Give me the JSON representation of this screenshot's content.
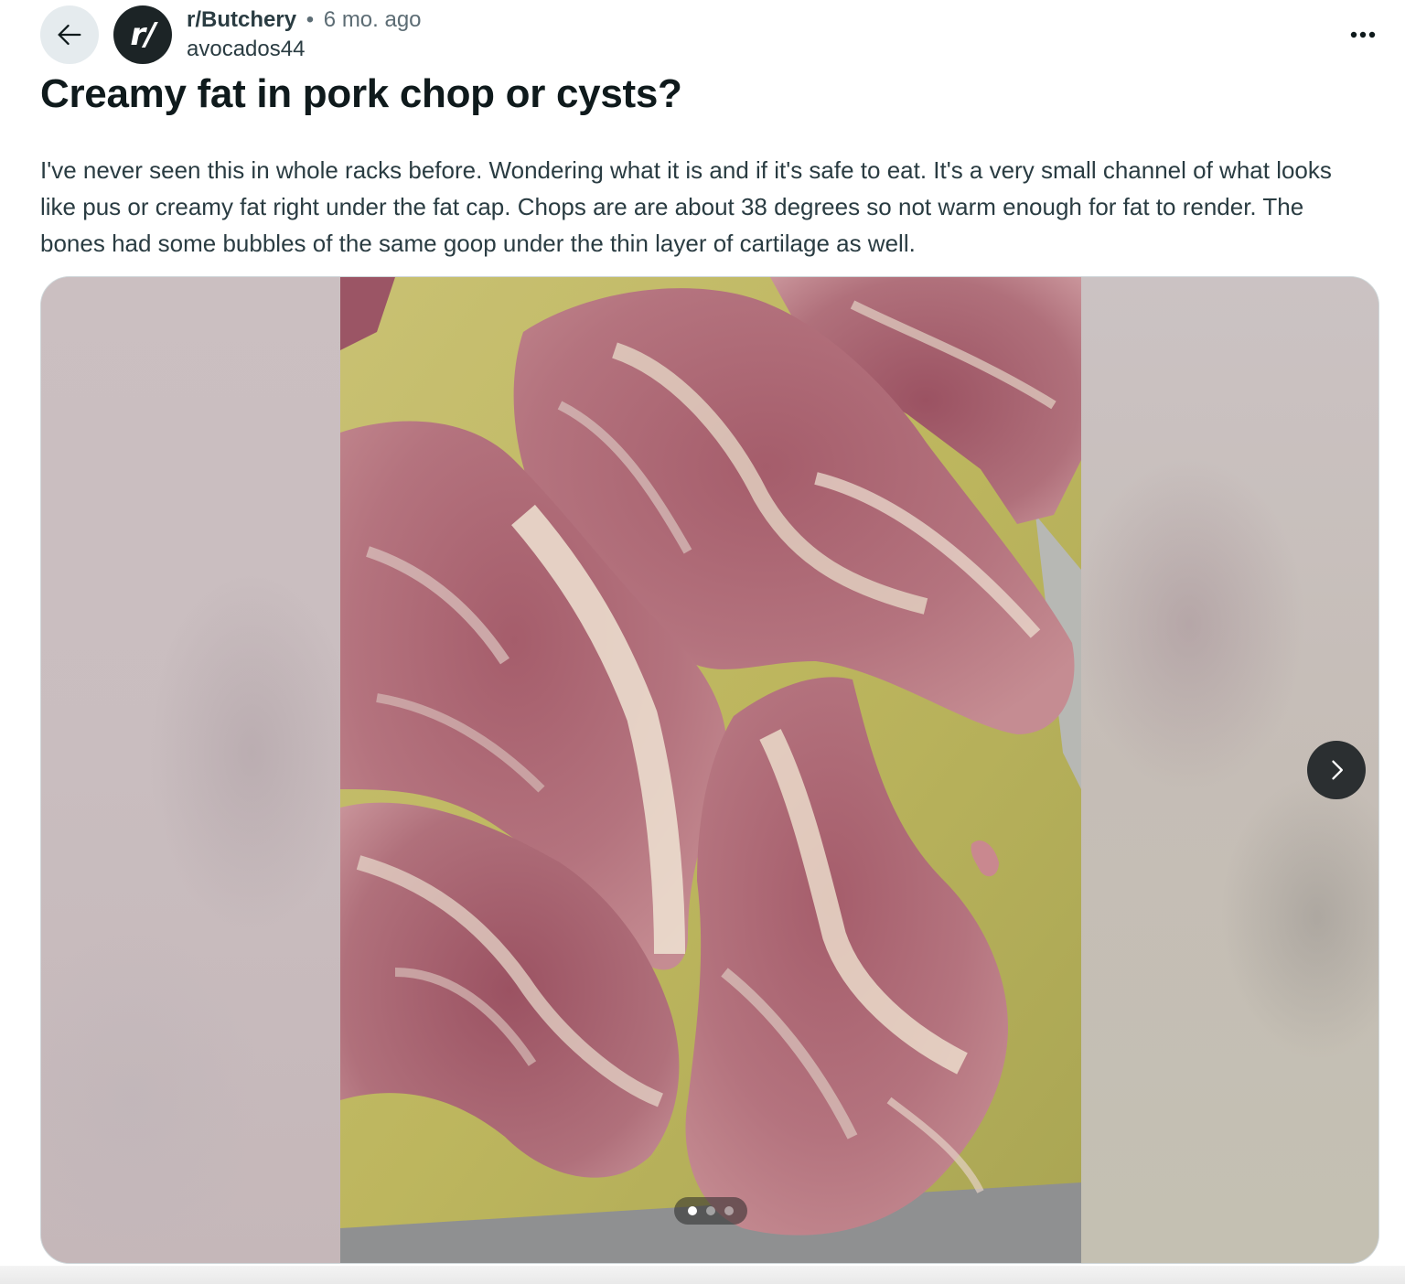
{
  "header": {
    "back_icon": "arrow-left-icon",
    "subreddit_avatar_text": "r/",
    "subreddit": "r/Butchery",
    "separator": "•",
    "time_ago": "6 mo. ago",
    "author": "avocados44",
    "more_icon": "more-horizontal-icon"
  },
  "post": {
    "title": "Creamy fat in pork chop or cysts?",
    "body": "I've never seen this in whole racks before. Wondering what it is and if it's safe to eat. It's a very small channel of what looks like pus or creamy fat right under the fat cap. Chops are are about 38 degrees so not warm enough for fat to render. The bones had some bubbles of the same goop under the thin layer of cartilage as well."
  },
  "gallery": {
    "image_count": 3,
    "current_index": 1,
    "next_icon": "chevron-right-icon",
    "colors": {
      "board": "#bdb65e",
      "meat": "#b1717c",
      "fat": "#e6d8c4",
      "lean": "#93505f"
    }
  }
}
